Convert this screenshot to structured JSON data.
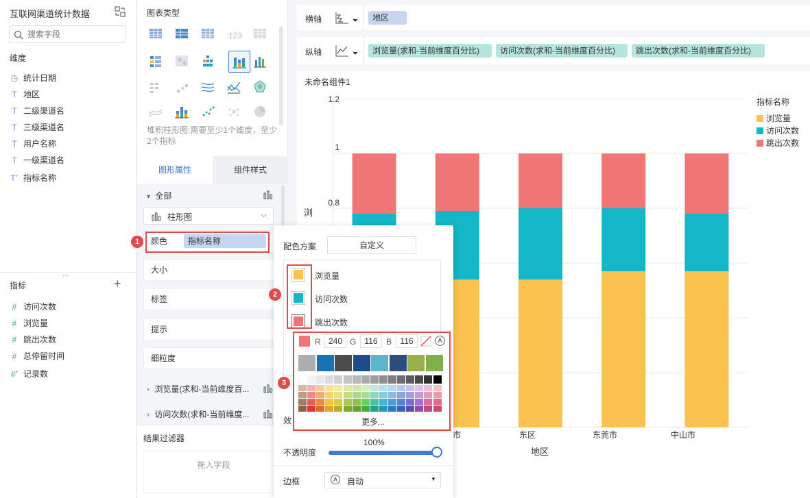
{
  "dataset": {
    "title": "互联网渠道统计数据"
  },
  "search": {
    "placeholder": "搜索字段"
  },
  "dimensions": {
    "header": "维度",
    "items": [
      {
        "label": "统计日期",
        "icon": "clock-icon"
      },
      {
        "label": "地区",
        "icon": "text-type-icon"
      },
      {
        "label": "二级渠道名",
        "icon": "text-type-icon"
      },
      {
        "label": "三级渠道名",
        "icon": "text-type-icon"
      },
      {
        "label": "用户名称",
        "icon": "text-type-icon"
      },
      {
        "label": "一级渠道名",
        "icon": "text-type-icon"
      },
      {
        "label": "指标名称",
        "icon": "text-type-icon"
      }
    ]
  },
  "metrics": {
    "header": "指标",
    "items": [
      {
        "label": "访问次数"
      },
      {
        "label": "浏览量"
      },
      {
        "label": "跳出次数"
      },
      {
        "label": "总停留时间"
      },
      {
        "label": "记录数"
      }
    ]
  },
  "chart_types": {
    "header": "图表类型",
    "hint": "堆积柱形图:需要至少1个维度，至少2个指标"
  },
  "tabs": {
    "graph_props": "图形属性",
    "component_style": "组件样式"
  },
  "properties": {
    "all_label": "全部",
    "chart_select": "柱形图",
    "color_label": "颜色",
    "color_tag": "指标名称",
    "size_label": "大小",
    "label_label": "标签",
    "tooltip_label": "提示",
    "granularity_label": "细粒度",
    "series1": "浏览量(求和-当前维度百...",
    "series2": "访问次数(求和-当前维度..."
  },
  "filter": {
    "header": "结果过滤器",
    "drop_hint": "拖入字段"
  },
  "axes": {
    "x_label": "横轴",
    "x_tag": "地区",
    "y_label": "纵轴",
    "y_tags": [
      "浏览量(求和-当前维度百分比)",
      "访问次数(求和-当前维度百分比)",
      "跳出次数(求和-当前维度百分比)"
    ]
  },
  "component": {
    "title": "未命名组件1"
  },
  "chart_data": {
    "type": "bar",
    "stacked": true,
    "categories": [
      "",
      "",
      "东区",
      "东莞市",
      "中山市"
    ],
    "visible_category_fragments": [
      "",
      "市",
      "东区",
      "东莞市",
      "中山市"
    ],
    "xlabel": "地区",
    "ylabel": "浏",
    "yticks": [
      "1.2",
      "1",
      "0.8"
    ],
    "ylim": [
      0,
      1.2
    ],
    "legend_title": "指标名称",
    "legend_position": "right",
    "series": [
      {
        "name": "浏览量",
        "color": "#fcc24f",
        "values": [
          0.57,
          0.54,
          0.54,
          0.57,
          0.57
        ]
      },
      {
        "name": "访问次数",
        "color": "#13b7c7",
        "values": [
          0.21,
          0.25,
          0.26,
          0.23,
          0.21
        ]
      },
      {
        "name": "跳出次数",
        "color": "#f07576",
        "values": [
          0.22,
          0.21,
          0.2,
          0.2,
          0.22
        ]
      }
    ]
  },
  "color_popup": {
    "scheme_label": "配色方案",
    "scheme_value": "自定义",
    "items": [
      {
        "label": "浏览量",
        "color": "#fcc24f"
      },
      {
        "label": "访问次数",
        "color": "#13b7c7"
      },
      {
        "label": "跳出次数",
        "color": "#f07576"
      }
    ],
    "rgb": {
      "r_label": "R",
      "r": "240",
      "g_label": "G",
      "g": "116",
      "b_label": "B",
      "b": "116"
    },
    "current_color": "#f07474",
    "more": "更多...",
    "effect_fragment": "效",
    "opacity_label": "不透明度",
    "opacity_value": "100%",
    "opacity_fraction": 1.0,
    "border_label": "边框",
    "border_value": "自动"
  },
  "palette": {
    "main": [
      "#aeaeae",
      "#1573b6",
      "#4c4c4c",
      "#1c4c8c",
      "#5bb6c8",
      "#2d4e7c",
      "#9aae4a",
      "#7fb04c"
    ],
    "grays": [
      "#ffffff",
      "#f3f3f3",
      "#e8e8e8",
      "#dcdcdc",
      "#d0d0d0",
      "#c3c3c3",
      "#b7b7b7",
      "#aaaaaa",
      "#9c9c9c",
      "#8e8e8e",
      "#7e7e7e",
      "#6e6e6e",
      "#5d5d5d",
      "#494949",
      "#333333",
      "#000000"
    ],
    "rows": [
      [
        "#d8b8a8",
        "#f7b1b1",
        "#fbc9a0",
        "#fbe29a",
        "#f1eba5",
        "#dce9a8",
        "#cfe6a6",
        "#d3eec3",
        "#bfe7dc",
        "#b6e0ea",
        "#b8d8f0",
        "#b9c7ea",
        "#c7c2ea",
        "#dcc1e5",
        "#efbfd6",
        "#f5bfca"
      ],
      [
        "#c29a85",
        "#f38888",
        "#f9a86e",
        "#f8d36b",
        "#ebe07a",
        "#c8dc7c",
        "#b2d87c",
        "#a8e08e",
        "#8fd6c2",
        "#82cde0",
        "#86bde6",
        "#8aa6df",
        "#a39ce0",
        "#c69bd8",
        "#e597be",
        "#ed97ab"
      ],
      [
        "#a87a64",
        "#ec5b5b",
        "#f5863f",
        "#f4c23e",
        "#d8cd45",
        "#a9c94f",
        "#8ec24e",
        "#6bcc60",
        "#4bbfa3",
        "#46b5d2",
        "#4d9bd9",
        "#5684d0",
        "#7a6fcf",
        "#aa6ec7",
        "#d86aa4",
        "#e16c8a"
      ],
      [
        "#8e5f48",
        "#d83838",
        "#e26a1f",
        "#e0a821",
        "#b9ae27",
        "#86a72f",
        "#6aa032",
        "#3fae3f",
        "#26a083",
        "#2496b7",
        "#2a7cc1",
        "#3464b3",
        "#5a4eb2",
        "#8b4eaa",
        "#bf4a86",
        "#c94c6c"
      ]
    ]
  }
}
